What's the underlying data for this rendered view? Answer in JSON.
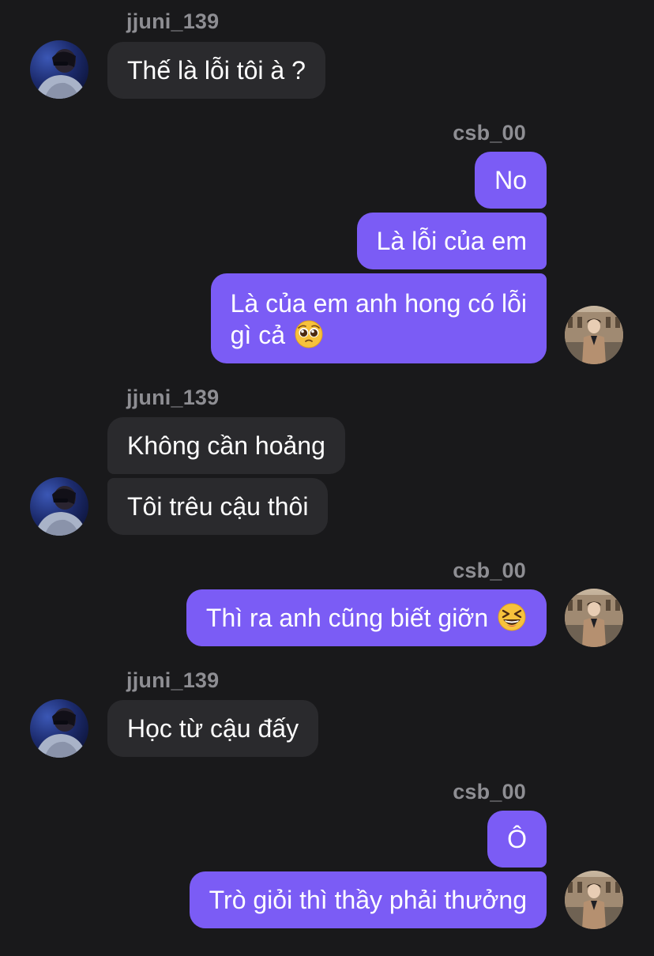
{
  "messages": {
    "g1": {
      "sender": "jjuni_139",
      "m1": "Thế là lỗi tôi à ?"
    },
    "g2": {
      "sender": "csb_00",
      "m1": "No",
      "m2": "Là lỗi của em",
      "m3_line1": "Là của em anh hong có lỗi",
      "m3_line2": "gì cả"
    },
    "g3": {
      "sender": "jjuni_139",
      "m1": "Không cần hoảng",
      "m2": "Tôi trêu cậu thôi"
    },
    "g4": {
      "sender": "csb_00",
      "m1": "Thì ra anh cũng biết giỡn"
    },
    "g5": {
      "sender": "jjuni_139",
      "m1": "Học từ cậu đấy"
    },
    "g6": {
      "sender": "csb_00",
      "m1": "Ô",
      "m2": "Trò giỏi thì thầy phải thưởng"
    }
  },
  "icons": {
    "pleading_emoji": "pleading-face-emoji",
    "laughing_emoji": "grinning-squinting-face-emoji",
    "left_avatar": "avatar-photo",
    "right_avatar": "avatar-photo"
  },
  "colors": {
    "background": "#19191b",
    "incoming_bubble": "#2a2a2d",
    "outgoing_bubble": "#7b5cf5",
    "username": "#8e8e93",
    "text": "#ffffff"
  }
}
